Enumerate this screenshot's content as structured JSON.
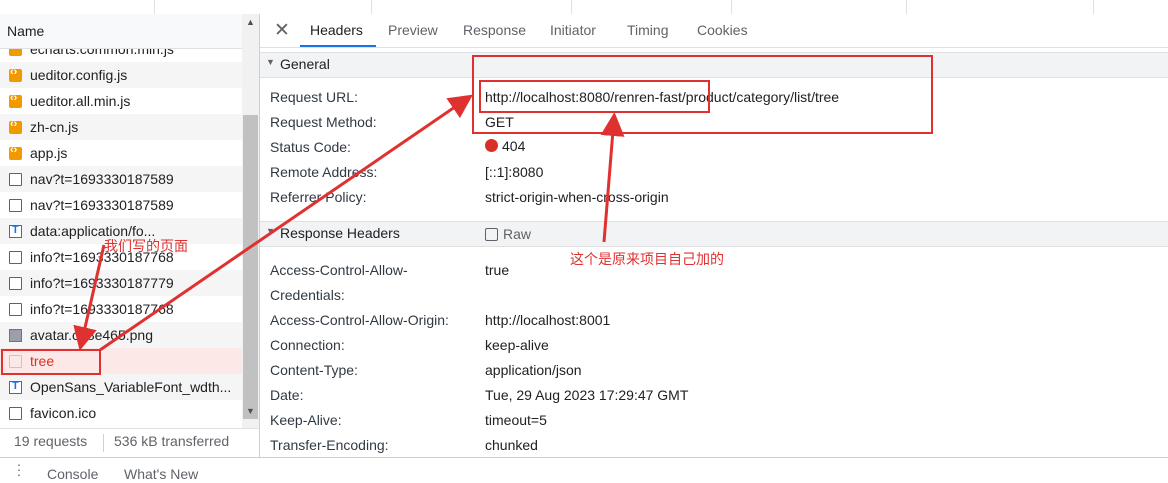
{
  "network_panel": {
    "name_column_label": "Name",
    "files": [
      {
        "name": "echarts.common.min.js",
        "icon": "js-file-icon"
      },
      {
        "name": "ueditor.config.js",
        "icon": "js-file-icon"
      },
      {
        "name": "ueditor.all.min.js",
        "icon": "js-file-icon"
      },
      {
        "name": "zh-cn.js",
        "icon": "js-file-icon"
      },
      {
        "name": "app.js",
        "icon": "js-file-icon"
      },
      {
        "name": "nav?t=1693330187589",
        "icon": "document-icon"
      },
      {
        "name": "nav?t=1693330187589",
        "icon": "document-icon"
      },
      {
        "name": "data:application/fo...",
        "icon": "font-file-icon"
      },
      {
        "name": "info?t=1693330187768",
        "icon": "document-icon"
      },
      {
        "name": "info?t=1693330187779",
        "icon": "document-icon"
      },
      {
        "name": "info?t=1693330187768",
        "icon": "document-icon"
      },
      {
        "name": "avatar.c58e465.png",
        "icon": "image-file-icon"
      },
      {
        "name": "tree",
        "icon": "document-icon",
        "selected": true
      },
      {
        "name": "OpenSans_VariableFont_wdth...",
        "icon": "font-file-icon"
      },
      {
        "name": "favicon.ico",
        "icon": "document-icon"
      }
    ],
    "summary": {
      "requests": "19 requests",
      "transferred": "536 kB transferred"
    }
  },
  "details": {
    "tabs": [
      "Headers",
      "Preview",
      "Response",
      "Initiator",
      "Timing",
      "Cookies"
    ],
    "active_tab": "Headers",
    "general": {
      "title": "General",
      "rows": [
        {
          "key": "Request URL:",
          "value": "http://localhost:8080/renren-fast/product/category/list/tree"
        },
        {
          "key": "Request Method:",
          "value": "GET"
        },
        {
          "key": "Status Code:",
          "value": "404"
        },
        {
          "key": "Remote Address:",
          "value": "[::1]:8080"
        },
        {
          "key": "Referrer Policy:",
          "value": "strict-origin-when-cross-origin"
        }
      ]
    },
    "response_headers": {
      "title": "Response Headers",
      "raw_label": "Raw",
      "rows": [
        {
          "key": "Access-Control-Allow-",
          "key_line2": "Credentials:",
          "value": "true"
        },
        {
          "key": "Access-Control-Allow-Origin:",
          "value": "http://localhost:8001"
        },
        {
          "key": "Connection:",
          "value": "keep-alive"
        },
        {
          "key": "Content-Type:",
          "value": "application/json"
        },
        {
          "key": "Date:",
          "value": "Tue, 29 Aug 2023 17:29:47 GMT"
        },
        {
          "key": "Keep-Alive:",
          "value": "timeout=5"
        },
        {
          "key": "Transfer-Encoding:",
          "value": "chunked"
        }
      ]
    }
  },
  "drawer": {
    "tabs": [
      "Console",
      "What's New"
    ]
  },
  "annotations": {
    "our_page": "我们写的页面",
    "original_project": "这个是原来项目自己加的",
    "color": "#e03131"
  },
  "colors": {
    "accent": "#1a73e8",
    "error": "#d93025",
    "selected_row_bg": "#fce8e6"
  }
}
